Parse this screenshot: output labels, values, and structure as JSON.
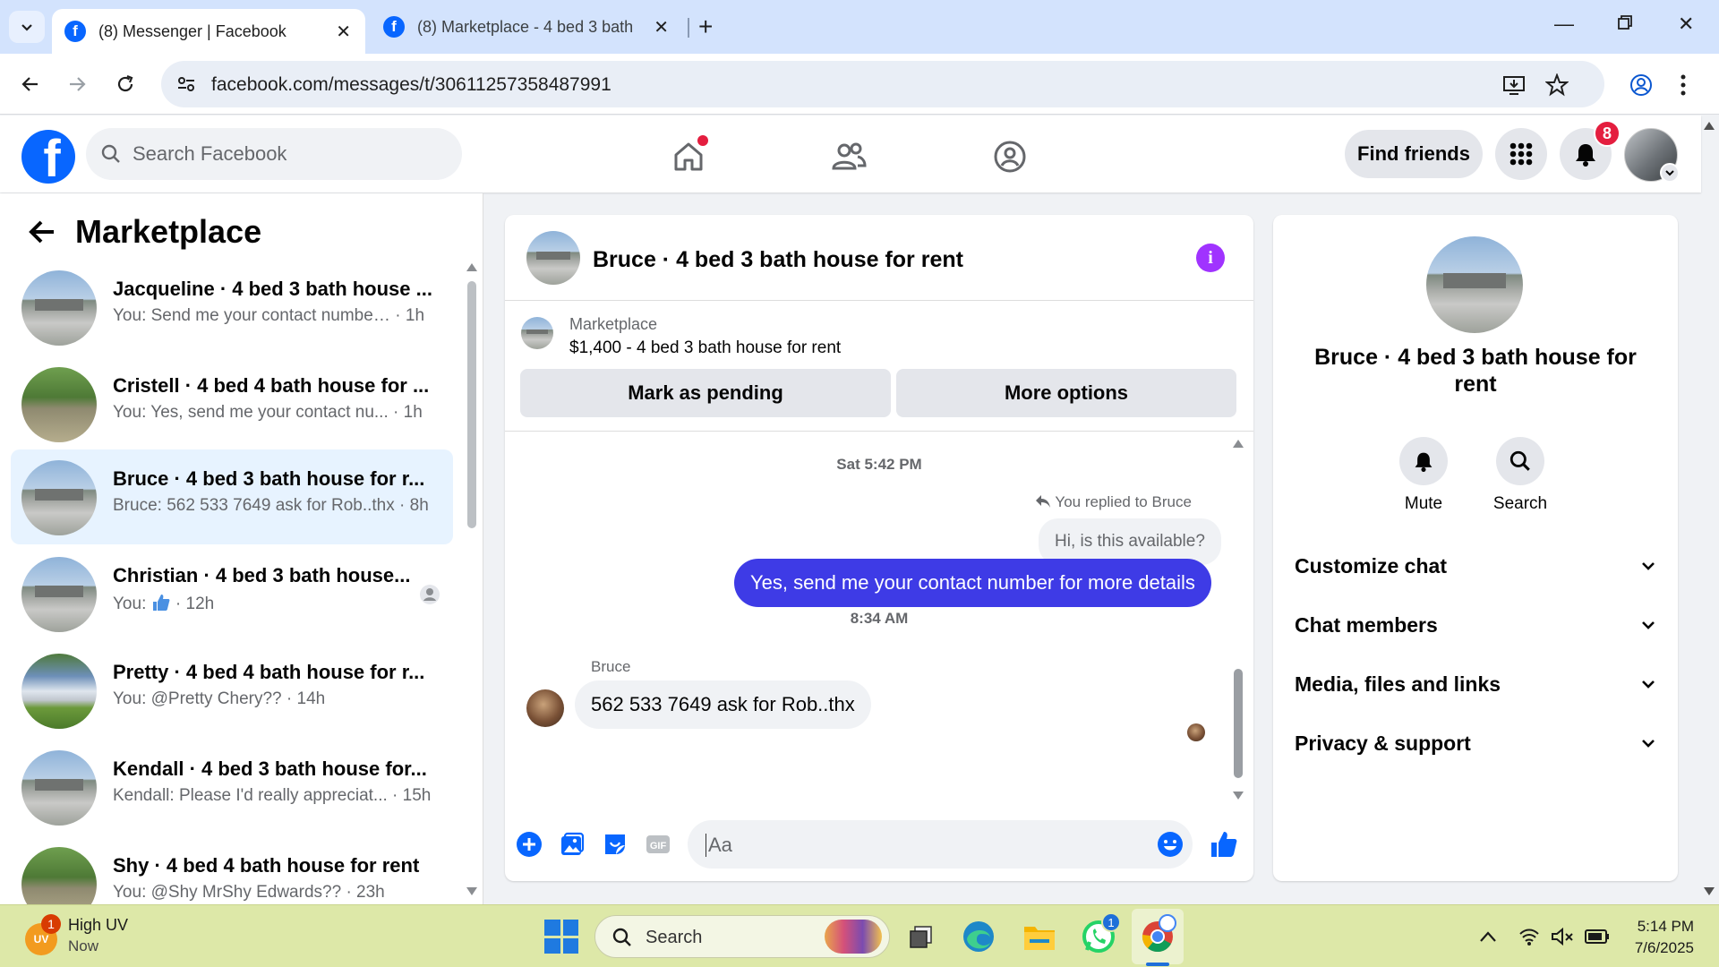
{
  "browser": {
    "tabs": [
      {
        "title": "(8) Messenger | Facebook",
        "active": true
      },
      {
        "title": "(8) Marketplace - 4 bed 3 bath house",
        "active": false
      }
    ],
    "url": "facebook.com/messages/t/30611257358487991"
  },
  "fb_header": {
    "search_placeholder": "Search Facebook",
    "find_friends_label": "Find friends",
    "notification_count": "8",
    "brand_color": "#0866ff"
  },
  "left_panel": {
    "title": "Marketplace",
    "conversations": [
      {
        "name": "Jacqueline · 4 bed 3 bath house ...",
        "preview": "You: Send me your contact number...",
        "time": "· 1h",
        "avatar": "house-icon"
      },
      {
        "name": "Cristell · 4 bed 4 bath house for ...",
        "preview": "You: Yes, send me your contact nu...",
        "time": "· 1h",
        "avatar": "house-icon"
      },
      {
        "name": "Bruce · 4 bed 3 bath house for r...",
        "preview": "Bruce: 562 533 7649 ask for Rob..thx",
        "time": "· 8h",
        "avatar": "house-icon",
        "selected": true
      },
      {
        "name": "Christian · 4 bed 3 bath house...",
        "preview": "You:",
        "time": "· 12h",
        "avatar": "house-icon"
      },
      {
        "name": "Pretty · 4 bed 4 bath house for r...",
        "preview": "You: @Pretty Chery??",
        "time": "· 14h",
        "avatar": "house-icon"
      },
      {
        "name": "Kendall · 4 bed 3 bath house for...",
        "preview": "Kendall: Please I'd really appreciat...",
        "time": "· 15h",
        "avatar": "house-icon"
      },
      {
        "name": "Shy · 4 bed 4 bath house for rent",
        "preview": "You: @Shy MrShy Edwards??",
        "time": "· 23h",
        "avatar": "house-icon"
      }
    ]
  },
  "chat": {
    "title": "Bruce · 4 bed 3 bath house for rent",
    "listing_label": "Marketplace",
    "listing_price": "$1,400 - 4 bed 3 bath house for rent",
    "mark_pending_label": "Mark as pending",
    "more_options_label": "More options",
    "timestamp_1": "Sat 5:42 PM",
    "reply_note": "You replied to Bruce",
    "quoted_message": "Hi, is this available?",
    "outgoing_message": "Yes, send me your contact number for more details",
    "timestamp_2": "8:34 AM",
    "sender_name": "Bruce",
    "incoming_message": "562 533 7649  ask for Rob..thx",
    "composer_placeholder": "Aa",
    "accent_color": "#3e3be6"
  },
  "right_panel": {
    "name": "Bruce · 4 bed 3 bath house for rent",
    "actions": [
      {
        "label": "Mute",
        "icon": "bell-icon"
      },
      {
        "label": "Search",
        "icon": "search-icon"
      }
    ],
    "sections": [
      "Customize chat",
      "Chat members",
      "Media, files and links",
      "Privacy & support"
    ]
  },
  "taskbar": {
    "weather_title": "High UV",
    "weather_sub": "Now",
    "weather_badge": "1",
    "weather_icon_text": "UV",
    "search_placeholder": "Search",
    "whatsapp_badge": "1",
    "time": "5:14 PM",
    "date": "7/6/2025"
  }
}
